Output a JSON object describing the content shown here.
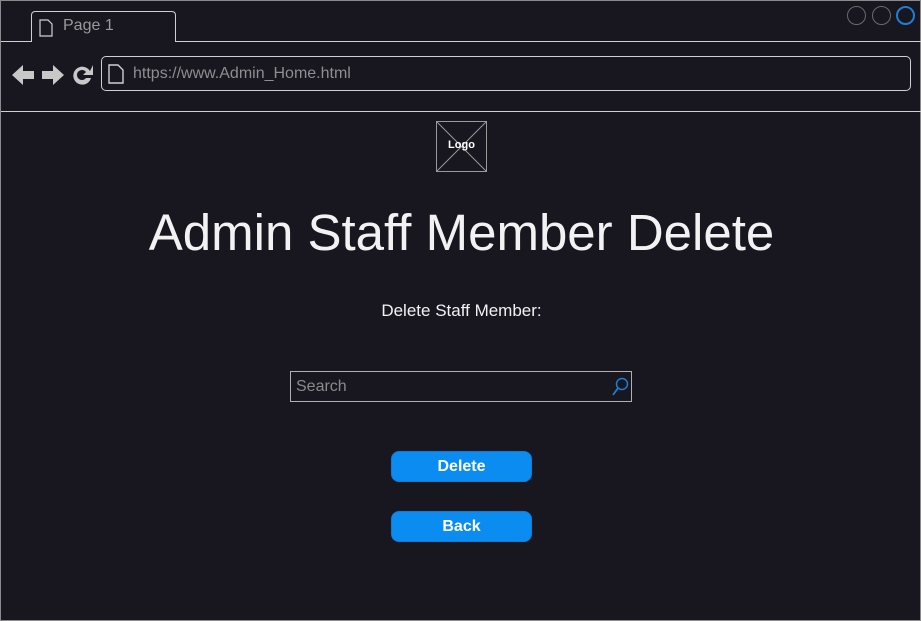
{
  "browser": {
    "tab_label": "Page 1",
    "url": "https://www.Admin_Home.html"
  },
  "logo": {
    "label": "Logo"
  },
  "page": {
    "title": "Admin Staff Member Delete",
    "subtitle": "Delete Staff Member:"
  },
  "search": {
    "placeholder": "Search",
    "value": ""
  },
  "buttons": {
    "delete_label": "Delete",
    "back_label": "Back"
  },
  "colors": {
    "background": "#18161f",
    "accent": "#0a8cf0",
    "active_window_button": "#1a7fd6"
  }
}
